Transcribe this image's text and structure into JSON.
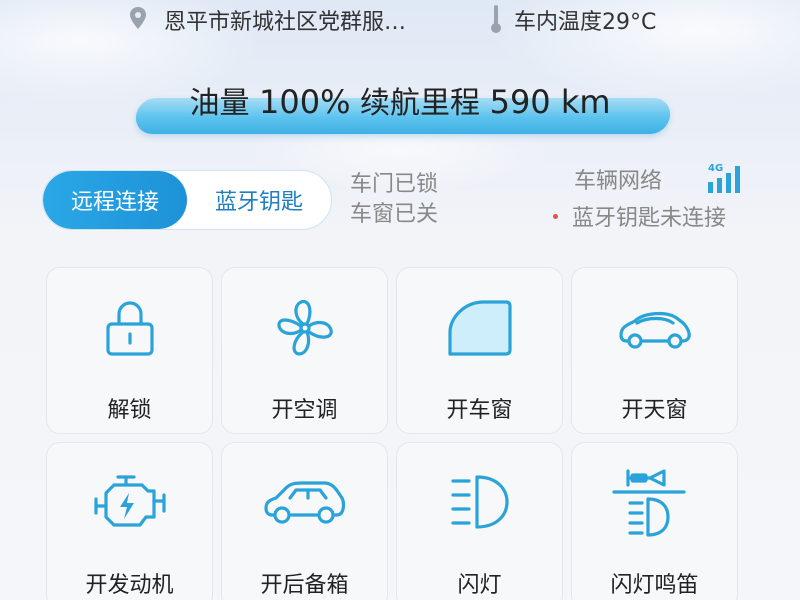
{
  "header": {
    "location": "恩平市新城社区党群服…",
    "temperature": "车内温度29°C"
  },
  "fuel": {
    "label_prefix": "油量",
    "fuel_value": "100%",
    "range_label": "续航里程",
    "range_value": "590 km"
  },
  "connection": {
    "tabs": [
      "远程连接",
      "蓝牙钥匙"
    ],
    "active_tab": "远程连接"
  },
  "vehicle_status": {
    "door": "车门已锁",
    "window": "车窗已关"
  },
  "network": {
    "label": "车辆网络",
    "signal_type": "4G",
    "bluetooth_status": "蓝牙钥匙未连接"
  },
  "controls": [
    {
      "label": "解锁",
      "icon": "lock-icon"
    },
    {
      "label": "开空调",
      "icon": "fan-icon"
    },
    {
      "label": "开车窗",
      "icon": "car-window-icon"
    },
    {
      "label": "开天窗",
      "icon": "sunroof-car-icon"
    },
    {
      "label": "开发动机",
      "icon": "engine-icon"
    },
    {
      "label": "开后备箱",
      "icon": "trunk-car-icon"
    },
    {
      "label": "闪灯",
      "icon": "headlight-icon"
    },
    {
      "label": "闪灯鸣笛",
      "icon": "horn-light-icon"
    }
  ],
  "colors": {
    "accent": "#2aa3d9",
    "active_tab": "#1d92d8",
    "warning_dot": "#e0554e"
  }
}
